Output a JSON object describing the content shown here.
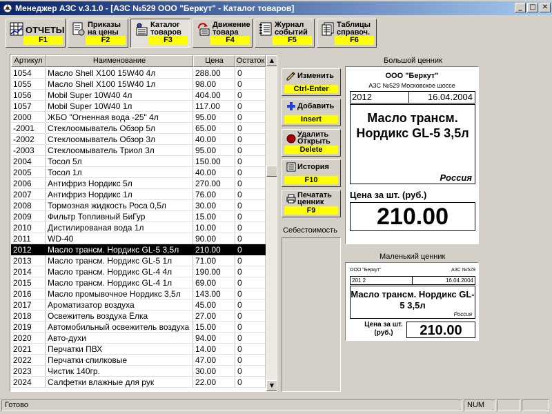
{
  "window": {
    "title": "Менеджер АЗС v.3.1.0 - [АЗС №529 ООО \"Беркут\" - Каталог товаров]",
    "minimize": "_",
    "maximize": "□",
    "close": "✕"
  },
  "toolbar": [
    {
      "line1": "ОТЧЕТЫ",
      "line2": "",
      "key": "F1",
      "icon": "reports-icon"
    },
    {
      "line1": "Приказы",
      "line2": "на цены",
      "key": "F2",
      "icon": "price-orders-icon"
    },
    {
      "line1": "Каталог",
      "line2": "товаров",
      "key": "F3",
      "icon": "catalog-icon",
      "active": true
    },
    {
      "line1": "Движение",
      "line2": "товара",
      "key": "F4",
      "icon": "goods-movement-icon"
    },
    {
      "line1": "Журнал",
      "line2": "событий",
      "key": "F5",
      "icon": "event-log-icon"
    },
    {
      "line1": "Таблицы",
      "line2": "справоч.",
      "key": "F6",
      "icon": "reference-tables-icon"
    }
  ],
  "grid": {
    "columns": [
      "Артикул",
      "Наименование",
      "Цена",
      "Остаток"
    ],
    "rows": [
      [
        "1054",
        "Масло Shell X100 15W40 4л",
        "288.00",
        "0"
      ],
      [
        "1055",
        "Масло Shell X100 15W40 1л",
        "98.00",
        "0"
      ],
      [
        "1056",
        "Mobil  Super 10W40  4л",
        "404.00",
        "0"
      ],
      [
        "1057",
        "Mobil  Super 10W40  1л",
        "117.00",
        "0"
      ],
      [
        "2000",
        "ЖБО \"Огненная вода -25\" 4л",
        "95.00",
        "0"
      ],
      [
        "-2001",
        "Стеклоомыватель  Обзор 5л",
        "65.00",
        "0"
      ],
      [
        "-2002",
        "Стеклоомыватель  Обзор 3л",
        "40.00",
        "0"
      ],
      [
        "-2003",
        "Стеклоомыватель  Триол 3л",
        "95.00",
        "0"
      ],
      [
        "2004",
        "Тосол  5л",
        "150.00",
        "0"
      ],
      [
        "2005",
        "Тосол  1л",
        "40.00",
        "0"
      ],
      [
        "2006",
        "Антифриз Нордикс  5л",
        "270.00",
        "0"
      ],
      [
        "2007",
        "Антифриз Нордикс  1л",
        "76.00",
        "0"
      ],
      [
        "2008",
        "Тормозная жидкость Роса  0,5л",
        "30.00",
        "0"
      ],
      [
        "2009",
        "Фильтр Топливный  БиГур",
        "15.00",
        "0"
      ],
      [
        "2010",
        "Дистилированая вода 1л",
        "10.00",
        "0"
      ],
      [
        "2011",
        "WD-40",
        "90.00",
        "0"
      ],
      [
        "2012",
        "Масло трансм. Нордикс GL-5 3,5л",
        "210.00",
        "0"
      ],
      [
        "2013",
        "Масло трансм. Нордикс GL-5 1л",
        "71.00",
        "0"
      ],
      [
        "2014",
        "Масло трансм. Нордикс  GL-4 4л",
        "190.00",
        "0"
      ],
      [
        "2015",
        "Масло трансм. Нордикс  GL-4 1л",
        "69.00",
        "0"
      ],
      [
        "2016",
        "Масло промывочное Нордикс 3,5л",
        "143.00",
        "0"
      ],
      [
        "2017",
        "Ароматизатор воздуха",
        "45.00",
        "0"
      ],
      [
        "2018",
        "Освежитель воздуха  Ёлка",
        "27.00",
        "0"
      ],
      [
        "2019",
        "Автомобильный освежитель воздуха",
        "15.00",
        "0"
      ],
      [
        "2020",
        "Авто-духи",
        "94.00",
        "0"
      ],
      [
        "2021",
        "Перчатки ПВХ",
        "14.00",
        "0"
      ],
      [
        "2022",
        "Перчатки спилковые",
        "47.00",
        "0"
      ],
      [
        "2023",
        "Чистик 140гр.",
        "30.00",
        "0"
      ],
      [
        "2024",
        "Салфетки влажные  для  рук",
        "22.00",
        "0"
      ]
    ],
    "selected_index": 16,
    "scroll_up": "▲",
    "scroll_down": "▼"
  },
  "actions": [
    {
      "line1": "Изменить",
      "line2": "",
      "key": "Ctrl-Enter",
      "icon": "pencil-icon"
    },
    {
      "line1": "Добавить",
      "line2": "",
      "key": "Insert",
      "icon": "plus-icon"
    },
    {
      "line1": "Удалить",
      "line2": "Открыть",
      "key": "Delete",
      "icon": "delete-circle-icon"
    },
    {
      "line1": "История",
      "line2": "",
      "key": "F10",
      "icon": "history-icon"
    },
    {
      "line1": "Печатать",
      "line2": "ценник",
      "key": "F9",
      "icon": "printer-icon"
    }
  ],
  "cost_label": "Себестоимость",
  "big_tag": {
    "section_label": "Большой ценник",
    "company": "ООО \"Беркут\"",
    "station": "АЗС №529 Московское шоссе",
    "code": "2012",
    "date": "16.04.2004",
    "name": "Масло трансм. Нордикс GL-5 3,5л",
    "country": "Россия",
    "price_label": "Цена за шт. (руб.)",
    "price": "210.00"
  },
  "small_tag": {
    "section_label": "Маленький ценник",
    "company": "ООО \"Беркут\"",
    "station": "АЗС №529",
    "code": "201 2",
    "date": "16.04.2004",
    "name": "Масло трансм. Нордикс GL-5 3,5л",
    "country": "Россия",
    "price_label": "Цена за шт. (руб.)",
    "price": "210.00"
  },
  "status": {
    "text": "Готово",
    "num": "NUM"
  },
  "colors": {
    "title_start": "#0a246a",
    "title_end": "#a6caf0",
    "hotkey_bg": "#ffff00",
    "selection_bg": "#000000",
    "window_bg": "#d4d0c8"
  }
}
